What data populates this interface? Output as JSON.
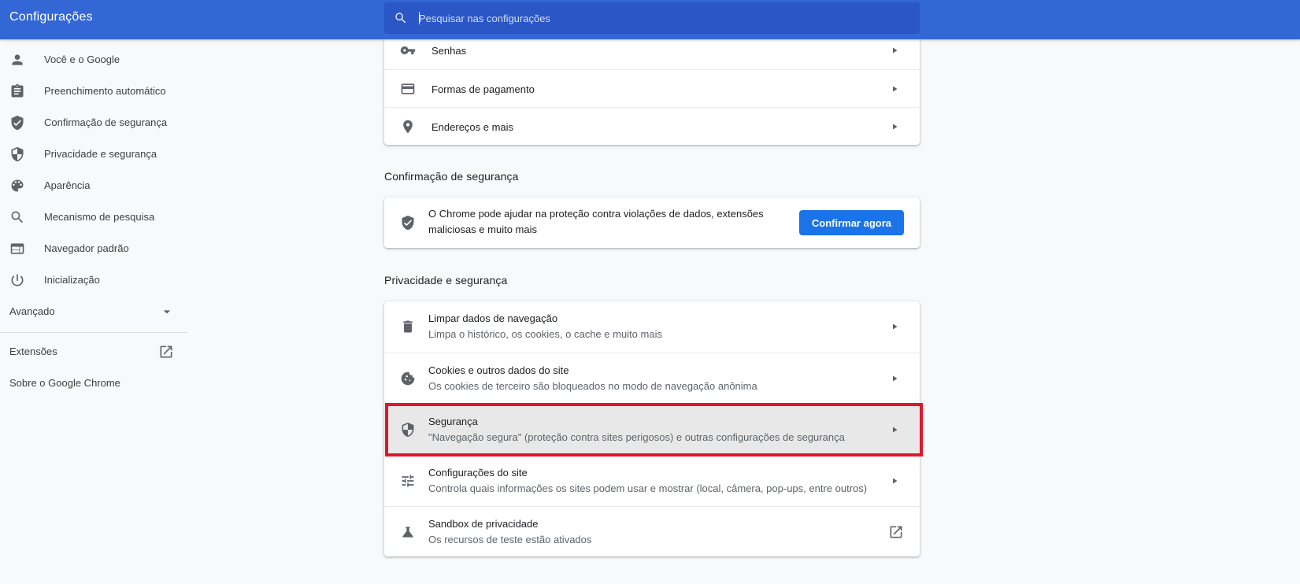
{
  "header": {
    "title": "Configurações",
    "search_placeholder": "Pesquisar nas configurações"
  },
  "sidebar": {
    "items": [
      {
        "label": "Você e o Google",
        "icon": "person-icon"
      },
      {
        "label": "Preenchimento automático",
        "icon": "clipboard-icon"
      },
      {
        "label": "Confirmação de segurança",
        "icon": "shield-check-icon"
      },
      {
        "label": "Privacidade e segurança",
        "icon": "shield-half-icon"
      },
      {
        "label": "Aparência",
        "icon": "palette-icon"
      },
      {
        "label": "Mecanismo de pesquisa",
        "icon": "search-icon"
      },
      {
        "label": "Navegador padrão",
        "icon": "browser-icon"
      },
      {
        "label": "Inicialização",
        "icon": "power-icon"
      }
    ],
    "advanced_label": "Avançado",
    "extensions_label": "Extensões",
    "about_label": "Sobre o Google Chrome"
  },
  "autofill": {
    "rows": [
      {
        "title": "Senhas",
        "icon": "key-icon"
      },
      {
        "title": "Formas de pagamento",
        "icon": "credit-card-icon"
      },
      {
        "title": "Endereços e mais",
        "icon": "location-pin-icon"
      }
    ]
  },
  "safety_check": {
    "heading": "Confirmação de segurança",
    "text": "O Chrome pode ajudar na proteção contra violações de dados, extensões maliciosas e muito mais",
    "button_label": "Confirmar agora"
  },
  "privacy": {
    "heading": "Privacidade e segurança",
    "rows": [
      {
        "title": "Limpar dados de navegação",
        "sub": "Limpa o histórico, os cookies, o cache e muito mais",
        "icon": "trash-icon"
      },
      {
        "title": "Cookies e outros dados do site",
        "sub": "Os cookies de terceiro são bloqueados no modo de navegação anônima",
        "icon": "cookie-icon"
      },
      {
        "title": "Segurança",
        "sub": "\"Navegação segura\" (proteção contra sites perigosos) e outras configurações de segurança",
        "icon": "shield-half-icon"
      },
      {
        "title": "Configurações do site",
        "sub": "Controla quais informações os sites podem usar e mostrar (local, câmera, pop-ups, entre outros)",
        "icon": "tune-icon"
      },
      {
        "title": "Sandbox de privacidade",
        "sub": "Os recursos de teste estão ativados",
        "icon": "flask-icon"
      }
    ]
  },
  "colors": {
    "header_bg": "#3367d6",
    "search_bg": "#2a56c6",
    "primary_button": "#1a73e8",
    "highlight_frame": "#e0162b"
  }
}
